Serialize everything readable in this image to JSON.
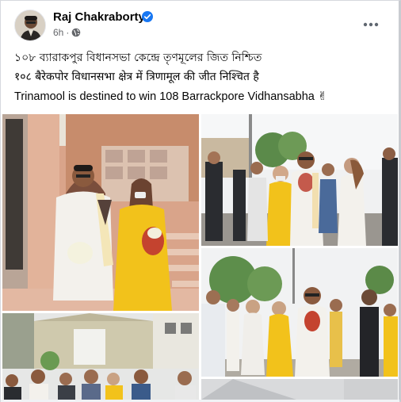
{
  "post": {
    "author": "Raj Chakraborty",
    "time": "6h",
    "audience_icon": "globe-icon",
    "verified_icon": "verified-badge-icon",
    "more_icon": "more-options-icon",
    "lines": [
      "১০৮ ব্যারাকপুর বিধানসভা কেন্দ্রে  তৃণমূলের জিত নিশ্চিত",
      "१०८ बैरेकपोर विधानसभा क्षेत्र में त्रिणामूल की जीत निश्चित है",
      "Trinamool is destined to win 108 Barrackpore Vidhansabha ✌"
    ]
  },
  "colors": {
    "verified_blue": "#1877f2",
    "meta_gray": "#65676b",
    "saree_yellow": "#f2c21b",
    "kurta_white": "#f3f1ec"
  },
  "photos": [
    {
      "name": "photo-temple-steps"
    },
    {
      "name": "photo-street-walk"
    },
    {
      "name": "photo-crowd-road"
    },
    {
      "name": "photo-building-crowd"
    },
    {
      "name": "photo-partial"
    }
  ]
}
